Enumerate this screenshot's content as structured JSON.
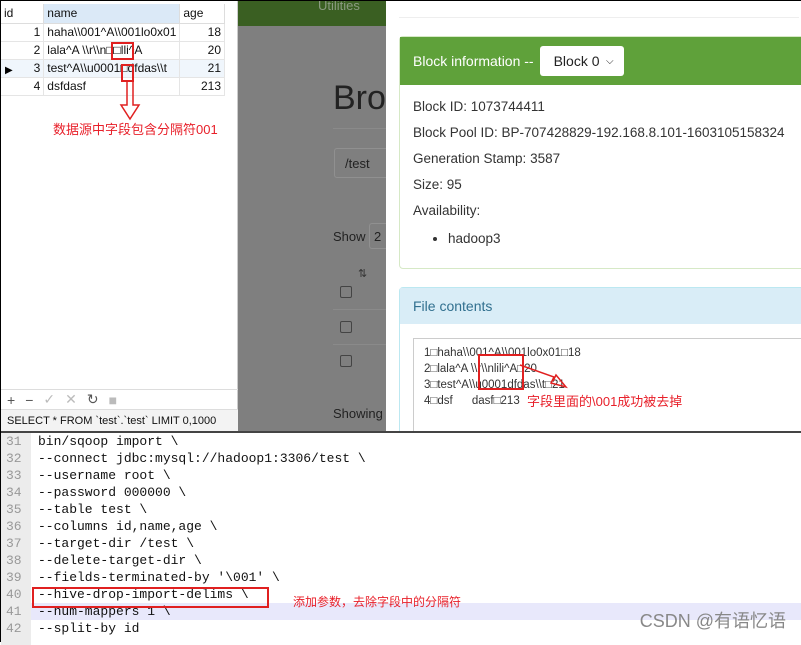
{
  "db_table": {
    "columns": [
      "id",
      "name",
      "age"
    ],
    "rows": [
      {
        "id": "1",
        "name": "haha\\\\001^A\\\\001lo0x01",
        "age": "18"
      },
      {
        "id": "2",
        "name": "lala^A \\\\r\\\\n□□lli^A",
        "age": "20"
      },
      {
        "id": "3",
        "name": "test^A\\\\u0001□dfdas\\\\t",
        "age": "21"
      },
      {
        "id": "4",
        "name": "dsfdasf",
        "age": "213"
      }
    ],
    "annotation": "数据源中字段包含分隔符001",
    "toolbar": {
      "add": "+",
      "remove": "−",
      "apply": "✓",
      "cancel": "✕",
      "refresh": "↻",
      "stop": "■"
    },
    "status": "SELECT * FROM `test`.`test` LIMIT 0,1000"
  },
  "hdfs_bg": {
    "nav": "Utilities",
    "title": "Brow",
    "path": "/test",
    "show_label": "Show",
    "show_value": "2",
    "showing": "Showing"
  },
  "modal": {
    "block_header": "Block information --",
    "block_select": "Block 0",
    "block_id": "Block ID: 1073744411",
    "block_pool": "Block Pool ID: BP-707428829-192.168.8.101-1603105158324",
    "gen_stamp": "Generation Stamp: 3587",
    "size": "Size: 95",
    "availability": "Availability:",
    "nodes": [
      "hadoop3"
    ],
    "file_header": "File contents",
    "file_lines": [
      "1□haha\\\\001^A\\\\001lo0x01□18",
      "2□lala^A \\\\r\\\\nlili^A□20",
      "3□test^A\\\\u0001dfdas\\\\t□21",
      "4□dsf      dasf□213"
    ],
    "annotation": "字段里面的\\001成功被去掉"
  },
  "code": {
    "lines": [
      {
        "n": "31",
        "t": "bin/sqoop import \\"
      },
      {
        "n": "32",
        "t": "--connect jdbc:mysql://hadoop1:3306/test \\"
      },
      {
        "n": "33",
        "t": "--username root \\"
      },
      {
        "n": "34",
        "t": "--password 000000 \\"
      },
      {
        "n": "35",
        "t": "--table test \\"
      },
      {
        "n": "36",
        "t": "--columns id,name,age \\"
      },
      {
        "n": "37",
        "t": "--target-dir /test \\"
      },
      {
        "n": "38",
        "t": "--delete-target-dir \\"
      },
      {
        "n": "39",
        "t": "--fields-terminated-by '\\001' \\"
      },
      {
        "n": "40",
        "t": "--hive-drop-import-delims \\"
      },
      {
        "n": "41",
        "t": "--num-mappers 1 \\"
      },
      {
        "n": "42",
        "t": "--split-by id"
      }
    ],
    "annotation": "添加参数，去除字段中的分隔符"
  },
  "watermark": "CSDN @有语忆语",
  "colors": {
    "annotation": "#e8202a",
    "block_header": "#5fa13a",
    "file_header": "#d9edf7",
    "highlight_line": "#e8e8fb"
  }
}
